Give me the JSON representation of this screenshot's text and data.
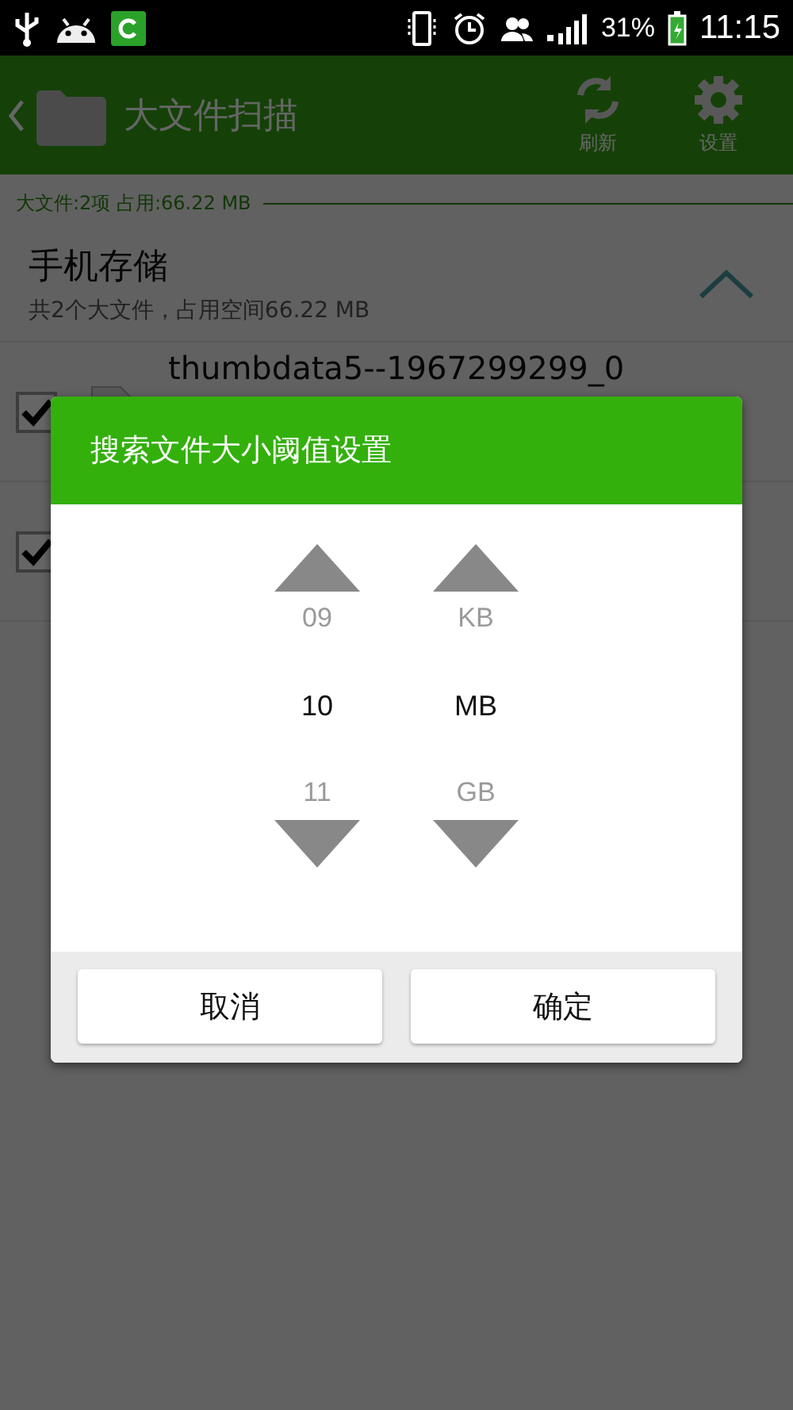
{
  "status_bar": {
    "battery": "31%",
    "time": "11:15"
  },
  "toolbar": {
    "title": "大文件扫描",
    "actions": [
      {
        "label": "刷新",
        "kind": "refresh"
      },
      {
        "label": "设置",
        "kind": "settings"
      }
    ]
  },
  "summary": "大文件:2项 占用:66.22 MB",
  "section": {
    "title": "手机存储",
    "subtitle": "共2个大文件，占用空间66.22 MB",
    "expanded": true
  },
  "files": [
    {
      "name": "thumbdata5--1967299299_0",
      "checked": true
    },
    {
      "checked": true
    }
  ],
  "dialog": {
    "title": "搜索文件大小阈值设置",
    "pickers": [
      {
        "previous": "09",
        "current": "10",
        "next": "11"
      },
      {
        "previous": "KB",
        "current": "MB",
        "next": "GB"
      }
    ],
    "buttons": [
      "取消",
      "确定"
    ]
  }
}
